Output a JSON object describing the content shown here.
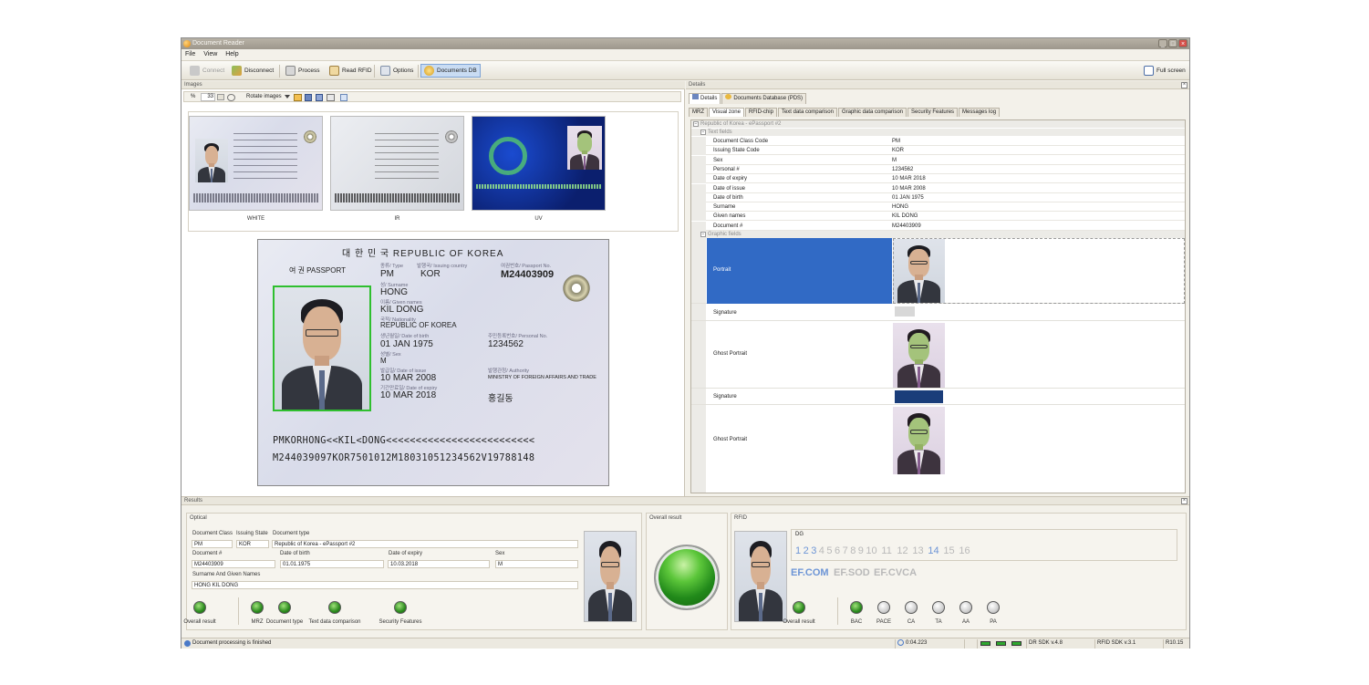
{
  "window": {
    "title": "Document Reader",
    "min_label": "_",
    "max_label": "□",
    "close_label": "×"
  },
  "menu": [
    "File",
    "View",
    "Help"
  ],
  "toolbar": {
    "connect": "Connect",
    "disconnect": "Disconnect",
    "process": "Process",
    "read_rfid": "Read RFID",
    "options": "Options",
    "documents_db": "Documents DB",
    "full_screen": "Full screen"
  },
  "images_panel": {
    "title": "Images",
    "zoom_symbol": "%",
    "zoom_value": "33",
    "rotate_label": "Rotate images",
    "thumbnails": [
      {
        "label": "WHITE"
      },
      {
        "label": "IR"
      },
      {
        "label": "UV"
      }
    ]
  },
  "passport": {
    "header": "대 한 민 국   REPUBLIC OF KOREA",
    "passport_word": "여 권  PASSPORT",
    "type_label": "종류/ Type",
    "country_label": "발행국/ Issuing country",
    "passport_no_label": "여권번호/ Passport No.",
    "type": "PM",
    "country": "KOR",
    "passport_no": "M24403909",
    "surname_label": "성/ Surname",
    "surname": "HONG",
    "given_label": "이름/ Given names",
    "given": "KIL DONG",
    "nationality_label": "국적/ Nationality",
    "nationality": "REPUBLIC OF KOREA",
    "dob_label": "생년월일/ Date of birth",
    "dob": "01 JAN 1975",
    "personal_label": "주민등록번호/ Personal No.",
    "personal_no": "1234562",
    "sex_label": "성별/ Sex",
    "sex": "M",
    "issue_label": "발급일/ Date of issue",
    "issue": "10 MAR 2008",
    "authority_label": "발행관청/ Authority",
    "authority": "MINISTRY OF FOREIGN AFFAIRS AND TRADE",
    "expiry_label": "기간만료일/ Date of expiry",
    "expiry": "10 MAR 2018",
    "korean_name": "홍길동",
    "mrz1": "PMKORHONG<<KIL<DONG<<<<<<<<<<<<<<<<<<<<<<<<<",
    "mrz2": "M244039097KOR7501012M1803105123456​2V19788148"
  },
  "details_panel": {
    "title": "Details",
    "top_tabs": [
      "Details",
      "Documents Database (PDS)"
    ],
    "tabs": [
      "MRZ",
      "Visual zone",
      "RFID-chip",
      "Text data comparison",
      "Graphic data comparison",
      "Security Features",
      "Messages log"
    ],
    "root": "Republic of Korea - ePassport #2",
    "text_fields_label": "Text fields",
    "text_fields": [
      {
        "label": "Document Class Code",
        "value": "PM"
      },
      {
        "label": "Issuing State Code",
        "value": "KOR"
      },
      {
        "label": "Sex",
        "value": "M"
      },
      {
        "label": "Personal #",
        "value": "1234562"
      },
      {
        "label": "Date of expiry",
        "value": "10 MAR 2018"
      },
      {
        "label": "Date of issue",
        "value": "10 MAR 2008"
      },
      {
        "label": "Date of birth",
        "value": "01 JAN 1975"
      },
      {
        "label": "Surname",
        "value": "HONG"
      },
      {
        "label": "Given names",
        "value": "KIL DONG"
      },
      {
        "label": "Document #",
        "value": "M24403909"
      }
    ],
    "graphic_fields_label": "Graphic fields",
    "graphic_fields": [
      "Portrait",
      "Signature",
      "Ghost Portrait",
      "Signature",
      "Ghost Portrait"
    ]
  },
  "results_panel": {
    "title": "Results",
    "optical": {
      "title": "Optical",
      "doc_class_label": "Document Class",
      "issuing_state_label": "Issuing State",
      "doc_type_label": "Document type",
      "doc_class": "PM",
      "issuing_state": "KOR",
      "doc_type": "Republic of Korea - ePassport #2",
      "doc_no_label": "Document #",
      "dob_label": "Date of birth",
      "expiry_label": "Date of expiry",
      "sex_label": "Sex",
      "doc_no": "M24403909",
      "dob": "01.01.1975",
      "expiry": "10.03.2018",
      "sex": "M",
      "name_label": "Surname And Given Names",
      "name": "HONG KIL DONG",
      "leds": [
        "Overall result",
        "MRZ",
        "Document type",
        "Text data comparison",
        "Security Features"
      ]
    },
    "overall": {
      "title": "Overall result"
    },
    "rfid": {
      "title": "RFID",
      "dg_label": "DG",
      "dg_numbers": [
        "1",
        "2",
        "3",
        "4",
        "5",
        "6",
        "7",
        "8",
        "9",
        "10",
        "11",
        "12",
        "13",
        "14",
        "15",
        "16"
      ],
      "ef": [
        "EF.COM",
        "EF.SOD",
        "EF.CVCA"
      ],
      "leds": [
        "Overall result",
        "BAC",
        "PACE",
        "CA",
        "TA",
        "AA",
        "PA"
      ]
    }
  },
  "status": {
    "message": "Document processing is finished",
    "time": "0:04.223",
    "dr_sdk": "DR SDK v.4.8",
    "rfid_sdk": "RFID SDK v.3.1",
    "rev": "R10.15"
  },
  "colors": {
    "accent_select": "#316ac5",
    "uv_bg": "#0f2d8a",
    "dg_active": "#6d95d6",
    "dg_inactive": "#b9b9b9",
    "led_green": "#2b8a1e"
  }
}
